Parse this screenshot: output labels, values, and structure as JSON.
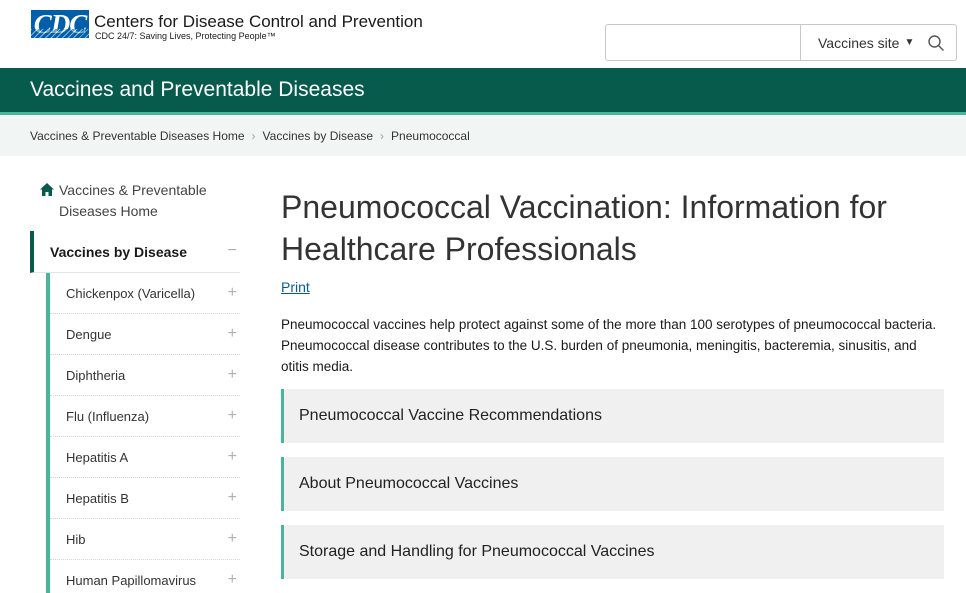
{
  "header": {
    "logo_text": "CDC",
    "org_name": "Centers for Disease Control and Prevention",
    "tagline": "CDC 24/7: Saving Lives, Protecting People™",
    "search": {
      "value": "",
      "placeholder": "",
      "scope_label": "Vaccines site",
      "scope_caret": "▼",
      "icon": "search-icon"
    }
  },
  "site_title": "Vaccines and Preventable Diseases",
  "breadcrumb": {
    "items": [
      "Vaccines & Preventable Diseases Home",
      "Vaccines by Disease",
      "Pneumococcal"
    ],
    "separator": ">"
  },
  "sidebar": {
    "home_label": "Vaccines & Preventable Diseases Home",
    "home_icon": "home-icon",
    "active_section": {
      "label": "Vaccines by Disease",
      "toggle": "−"
    },
    "items": [
      {
        "label": "Chickenpox (Varicella)",
        "toggle": "+"
      },
      {
        "label": "Dengue",
        "toggle": "+"
      },
      {
        "label": "Diphtheria",
        "toggle": "+"
      },
      {
        "label": "Flu (Influenza)",
        "toggle": "+"
      },
      {
        "label": "Hepatitis A",
        "toggle": "+"
      },
      {
        "label": "Hepatitis B",
        "toggle": "+"
      },
      {
        "label": "Hib",
        "toggle": "+"
      },
      {
        "label": "Human Papillomavirus",
        "toggle": "+"
      }
    ]
  },
  "main": {
    "title": "Pneumococcal Vaccination: Information for Healthcare Professionals",
    "print_label": "Print",
    "intro": "Pneumococcal vaccines help protect against some of the more than 100 serotypes of pneumococcal bacteria. Pneumococcal disease contributes to the U.S. burden of pneumonia, meningitis, bacteremia, sinusitis, and otitis media.",
    "accordions": [
      {
        "label": "Pneumococcal Vaccine Recommendations"
      },
      {
        "label": "About Pneumococcal Vaccines"
      },
      {
        "label": "Storage and Handling for Pneumococcal Vaccines"
      }
    ]
  },
  "colors": {
    "brand_blue": "#005eaa",
    "site_band": "#075b4d",
    "accent_teal": "#4ab59d",
    "link": "#075b9d",
    "accordion_bg": "#f0f0f0"
  }
}
